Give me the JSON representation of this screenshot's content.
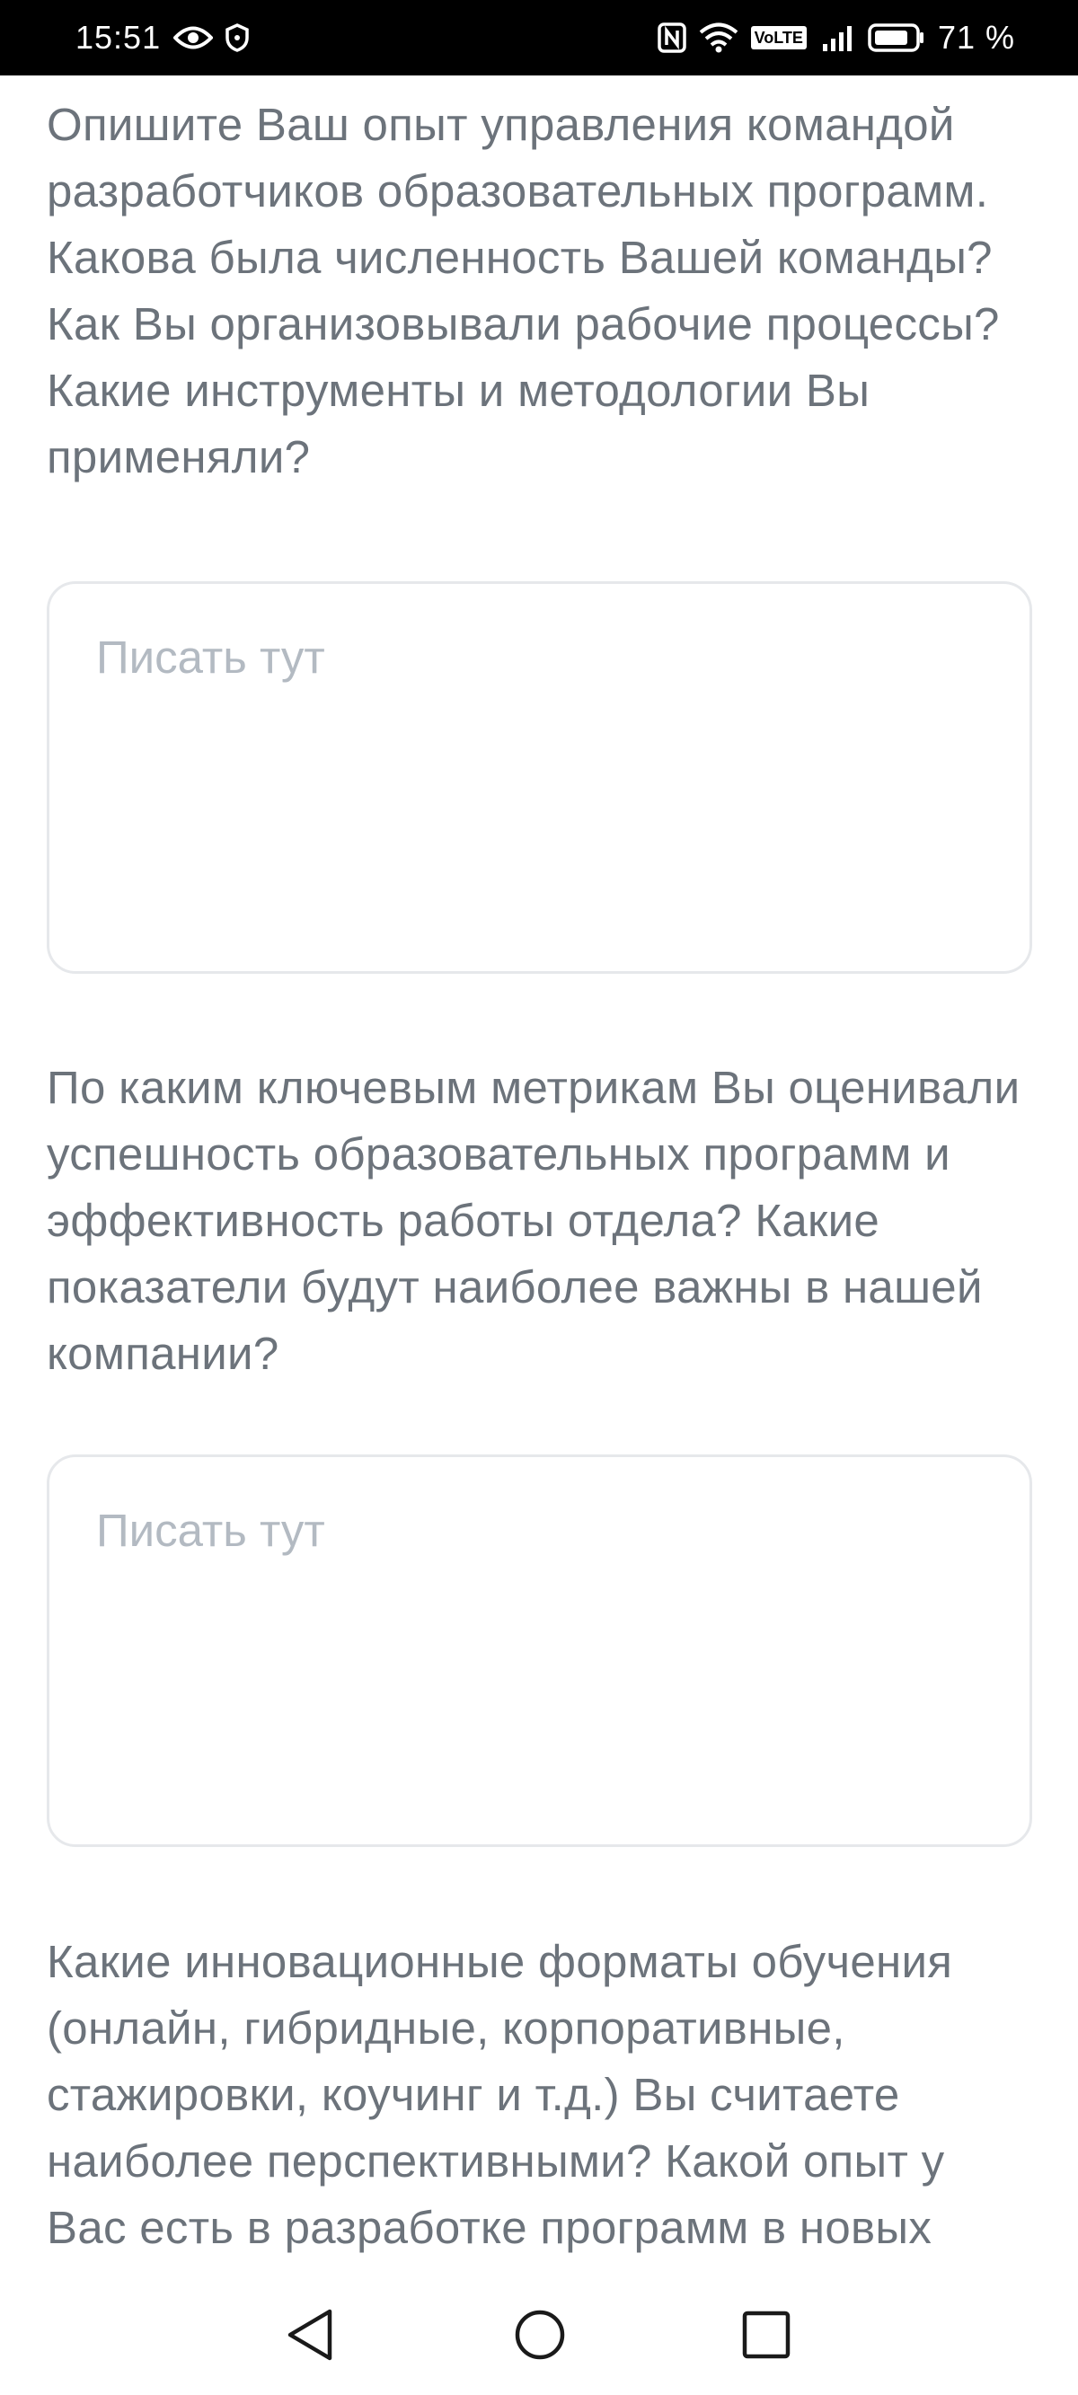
{
  "status_bar": {
    "time": "15:51",
    "network": "VoLTE",
    "battery_percent": "71 %",
    "icons": [
      "eye-icon",
      "shield-icon",
      "nfc-icon",
      "wifi-icon",
      "signal-icon",
      "battery-icon"
    ]
  },
  "questions": [
    {
      "text": "Опишите Ваш опыт управления командой разработчиков образовательных программ. Какова была численность Вашей команды? Как Вы организовывали рабочие процессы? Какие инструменты и методологии Вы применяли?",
      "placeholder": "Писать тут"
    },
    {
      "text": "По каким ключевым метрикам Вы оценивали успешность образовательных программ и эффективность работы отдела? Какие показатели будут наиболее важны в нашей компании?",
      "placeholder": "Писать тут"
    },
    {
      "text": "Какие инновационные форматы обучения (онлайн, гибридные, корпоративные, стажировки, коучинг и т.д.) Вы считаете наиболее перспективными? Какой опыт у Вас есть в разработке программ в новых"
    }
  ],
  "nav_bar": {
    "icons": [
      "back-icon",
      "home-icon",
      "recents-icon"
    ]
  },
  "colors": {
    "question_text": "#6c737b",
    "placeholder_text": "#b3bac2",
    "field_border": "#e6e8eb",
    "status_bar_bg": "#000000"
  }
}
